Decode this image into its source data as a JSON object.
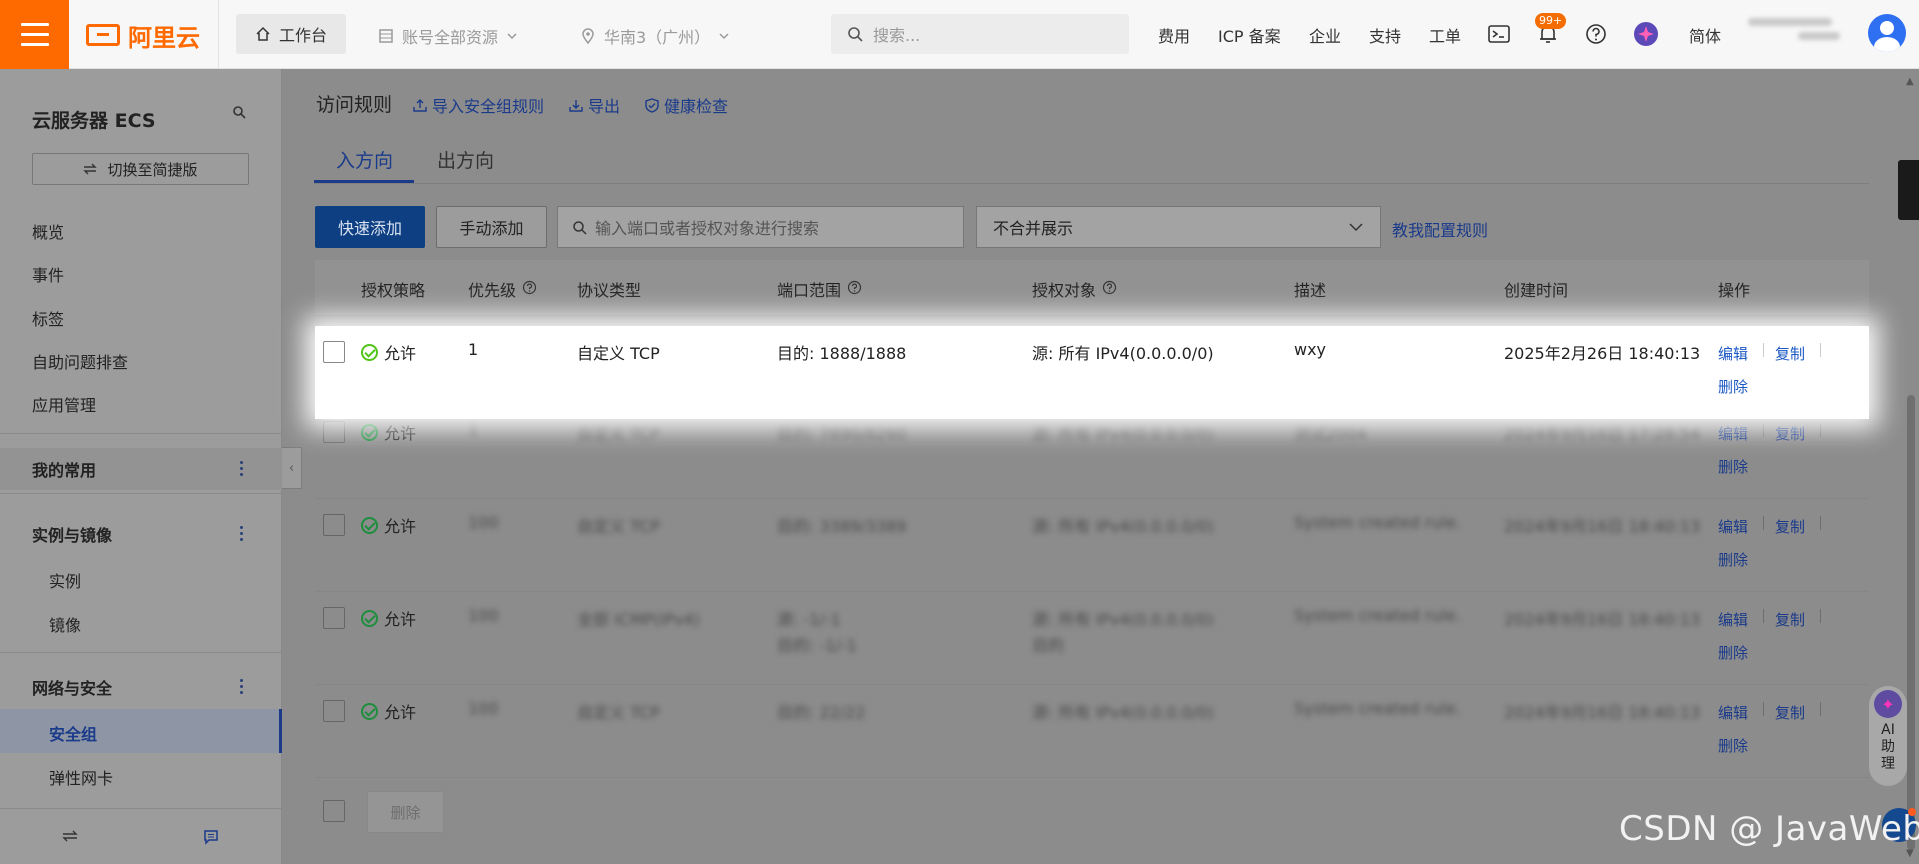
{
  "topbar": {
    "logo_text": "阿里云",
    "workbench": "工作台",
    "account": "账号全部资源",
    "region": "华南3（广州）",
    "search_placeholder": "搜索...",
    "nav": [
      "费用",
      "ICP 备案",
      "企业",
      "支持",
      "工单"
    ],
    "notification_badge": "99+",
    "language": "简体"
  },
  "sidebar": {
    "title": "云服务器 ECS",
    "switch_label": "切换至简捷版",
    "items": [
      "概览",
      "事件",
      "标签",
      "自助问题排查",
      "应用管理"
    ],
    "groups": [
      {
        "label": "我的常用",
        "children": []
      },
      {
        "label": "实例与镜像",
        "children": [
          "实例",
          "镜像"
        ]
      },
      {
        "label": "网络与安全",
        "children": [
          "安全组",
          "弹性网卡"
        ]
      }
    ],
    "active_item": "安全组"
  },
  "main": {
    "title": "访问规则",
    "actions": [
      "导入安全组规则",
      "导出",
      "健康检查"
    ],
    "tabs": [
      {
        "label": "入方向",
        "active": true
      },
      {
        "label": "出方向",
        "active": false
      }
    ],
    "quick_add": "快速添加",
    "manual_add": "手动添加",
    "search_placeholder": "输入端口或者授权对象进行搜索",
    "select_value": "不合并展示",
    "help_link": "教我配置规则",
    "delete_button": "删除"
  },
  "table": {
    "headers": [
      "授权策略",
      "优先级",
      "协议类型",
      "端口范围",
      "授权对象",
      "描述",
      "创建时间",
      "操作"
    ],
    "ops": {
      "edit": "编辑",
      "copy": "复制",
      "delete": "删除"
    },
    "rows": [
      {
        "policy": "允许",
        "priority": "1",
        "protocol": "自定义 TCP",
        "port": "目的: 1888/1888",
        "source": "源: 所有 IPv4(0.0.0.0/0)",
        "desc": "wxy",
        "created": "2025年2月26日 18:40:13",
        "highlighted": true
      },
      {
        "policy": "允许",
        "priority": "1",
        "protocol": "自定义 TCP",
        "port": "目的: 7890/8260",
        "source": "源: 所有 IPv4(0.0.0.0/0)",
        "desc": "测试2004",
        "created": "2024年9月16日 17:28:54",
        "highlighted": false
      },
      {
        "policy": "允许",
        "priority": "100",
        "protocol": "自定义 TCP",
        "port": "目的: 3389/3389",
        "source": "源: 所有 IPv4(0.0.0.0/0)",
        "desc": "System created rule.",
        "created": "2024年9月16日 18:40:13",
        "highlighted": false
      },
      {
        "policy": "允许",
        "priority": "100",
        "protocol": "全部 ICMP(IPv4)",
        "port": "源: -1/-1",
        "port2": "目的: -1/-1",
        "source": "源: 所有 IPv4(0.0.0.0/0)",
        "source2": "目的",
        "desc": "System created rule.",
        "created": "2024年9月16日 18:40:13",
        "highlighted": false
      },
      {
        "policy": "允许",
        "priority": "100",
        "protocol": "自定义 TCP",
        "port": "目的: 22/22",
        "source": "源: 所有 IPv4(0.0.0.0/0)",
        "desc": "System created rule.",
        "created": "2024年9月16日 18:40:13",
        "highlighted": false
      }
    ]
  },
  "assistant": {
    "label_line1": "AI",
    "label_line2": "助",
    "label_line3": "理"
  },
  "watermark": "CSDN @ JavaWeb"
}
